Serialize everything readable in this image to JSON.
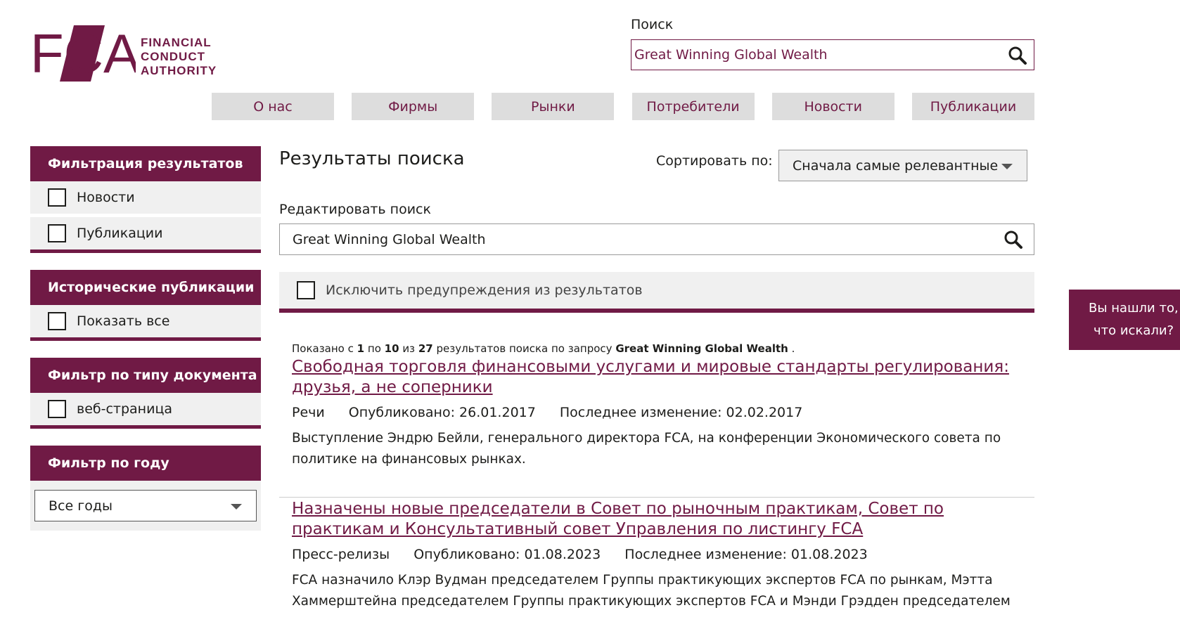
{
  "logo": {
    "letters": "FCA",
    "line1": "FINANCIAL",
    "line2": "CONDUCT",
    "line3": "AUTHORITY"
  },
  "header_search": {
    "label": "Поиск",
    "value": "Great Winning Global Wealth"
  },
  "nav": {
    "items": [
      {
        "label": "О нас"
      },
      {
        "label": "Фирмы"
      },
      {
        "label": "Рынки"
      },
      {
        "label": "Потребители"
      },
      {
        "label": "Новости"
      },
      {
        "label": "Публикации"
      }
    ]
  },
  "sidebar": {
    "filter_results": {
      "title": "Фильтрация результатов",
      "options": [
        "Новости",
        "Публикации"
      ]
    },
    "historic": {
      "title": "Исторические публикации",
      "options": [
        "Показать все"
      ]
    },
    "doc_type": {
      "title": "Фильтр по типу документа",
      "options": [
        "веб-страница"
      ]
    },
    "year": {
      "title": "Фильтр по году",
      "selected": "Все годы"
    }
  },
  "main": {
    "title": "Результаты поиска",
    "sort_label": "Сортировать по:",
    "sort_selected": "Сначала самые релевантные",
    "edit_label": "Редактировать поиск",
    "search_value": "Great Winning Global Wealth",
    "exclude_label": "Исключить предупреждения из результатов",
    "showing": {
      "prefix": "Показано с",
      "from": "1",
      "mid1": "по",
      "to": "10",
      "mid2": "из",
      "total": "27",
      "mid3": "результатов поиска по запросу",
      "query": "Great Winning Global Wealth",
      "suffix": "."
    },
    "results": [
      {
        "title": "Свободная торговля финансовыми услугами и мировые стандарты регулирования: друзья, а не соперники",
        "type": "Речи",
        "published": "Опубликовано: 26.01.2017",
        "modified": "Последнее изменение: 02.02.2017",
        "description": "Выступление Эндрю Бейли, генерального директора FCA, на конференции Экономического совета по политике на финансовых рынках."
      },
      {
        "title": "Назначены новые председатели в Совет по рыночным практикам, Совет по практикам и Консультативный совет Управления по листингу FCA",
        "type": "Пресс-релизы",
        "published": "Опубликовано: 01.08.2023",
        "modified": "Последнее изменение: 01.08.2023",
        "description": "FCA назначило Клэр Вудман председателем Группы практикующих экспертов FCA по рынкам, Мэтта Хаммерштейна председателем Группы практикующих экспертов FCA и Мэнди Грэдден председателем"
      }
    ]
  },
  "feedback": {
    "line1": "Вы нашли то,",
    "line2": "что искали?"
  },
  "colors": {
    "brand": "#701a45",
    "nav_bg": "#dddddd",
    "panel_bg": "#f0f0f0"
  },
  "icons": {
    "search": "search-icon",
    "dropdown": "chevron-down-icon",
    "checkbox": "checkbox-icon"
  }
}
